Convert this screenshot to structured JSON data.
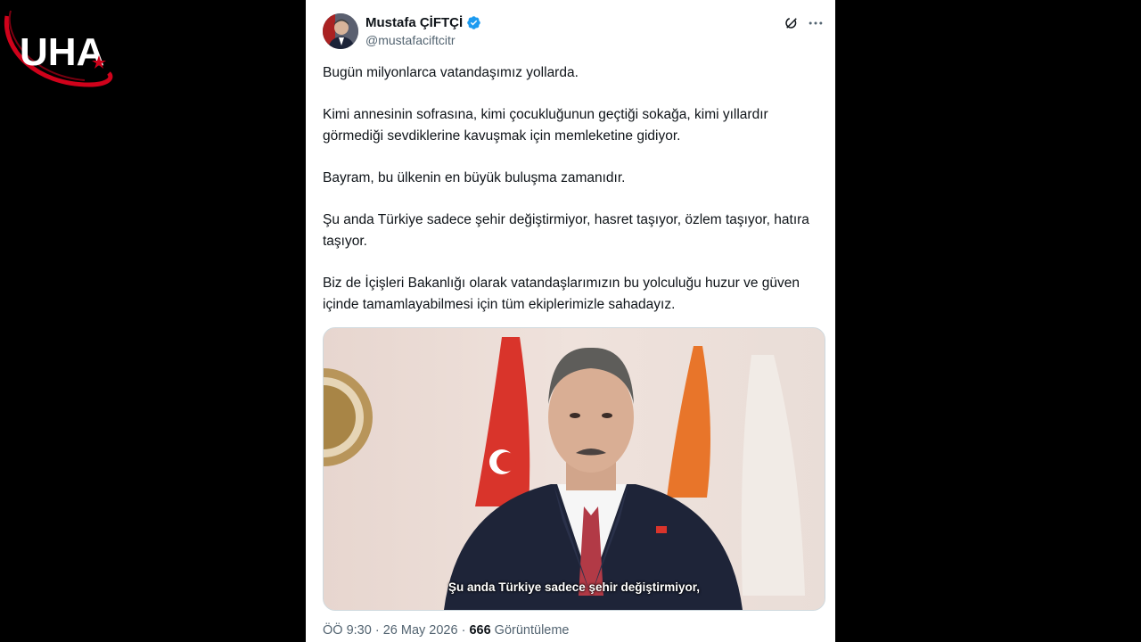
{
  "watermark": {
    "text": "UHA"
  },
  "tweet": {
    "author_name": "Mustafa ÇİFTÇİ",
    "author_handle": "@mustafaciftcitr",
    "verified_icon": "verified-badge-icon",
    "paragraphs": [
      "Bugün milyonlarca vatandaşımız yollarda.",
      "Kimi annesinin sofrasına, kimi çocukluğunun geçtiği sokağa, kimi yıllardır görmediği sevdiklerine kavuşmak için memleketine gidiyor.",
      "Bayram, bu ülkenin en büyük buluşma zamanıdır.",
      "Şu anda Türkiye sadece şehir değiştirmiyor, hasret taşıyor, özlem taşıyor, hatıra taşıyor.",
      "Biz de İçişleri Bakanlığı olarak vatandaşlarımızın bu yolculuğu huzur ve güven içinde tamamlayabilmesi için tüm ekiplerimizle sahadayız."
    ],
    "media": {
      "subtitle": "Şu anda Türkiye sadece şehir değiştirmiyor,"
    },
    "meta": {
      "time": "ÖÖ 9:30",
      "sep1": " · ",
      "date": "26 May 2026",
      "sep2": " · ",
      "views": "666",
      "views_label": "Görüntüleme"
    }
  },
  "colors": {
    "verified": "#1d9bf0",
    "text": "#0f1419",
    "muted": "#536471",
    "logo_red": "#d0021b"
  }
}
